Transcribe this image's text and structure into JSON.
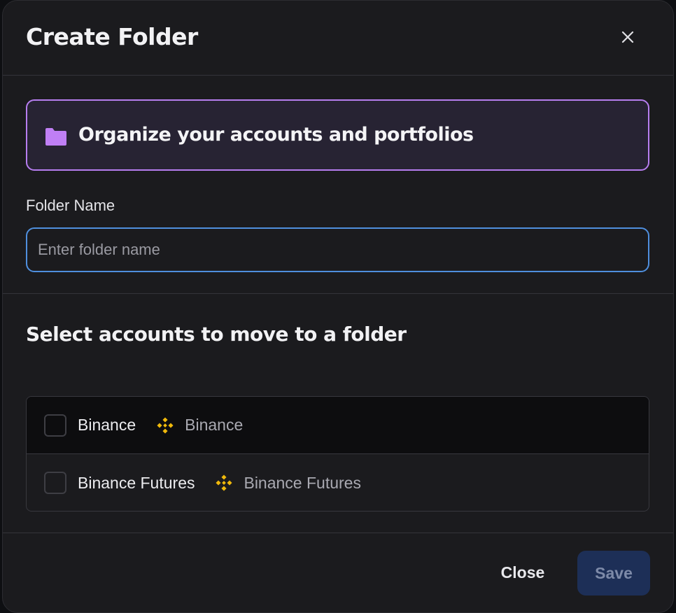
{
  "dialog": {
    "title": "Create Folder",
    "close_icon": "close-icon"
  },
  "banner": {
    "icon": "folder-icon",
    "icon_color": "#c07ff5",
    "text": "Organize your accounts and portfolios"
  },
  "form": {
    "folder_name_label": "Folder Name",
    "folder_name_value": "",
    "folder_name_placeholder": "Enter folder name"
  },
  "accounts_section": {
    "title": "Select accounts to move to a folder",
    "accounts": [
      {
        "name": "Binance",
        "exchange": "Binance",
        "exchange_icon": "binance-icon",
        "checked": false
      },
      {
        "name": "Binance Futures",
        "exchange": "Binance Futures",
        "exchange_icon": "binance-icon",
        "checked": false
      }
    ]
  },
  "footer": {
    "close_label": "Close",
    "save_label": "Save"
  },
  "colors": {
    "accent_purple": "#b77ef0",
    "input_focus_blue": "#4f8fde",
    "binance_yellow": "#f0b90b",
    "save_disabled_bg": "#1d2f57"
  }
}
